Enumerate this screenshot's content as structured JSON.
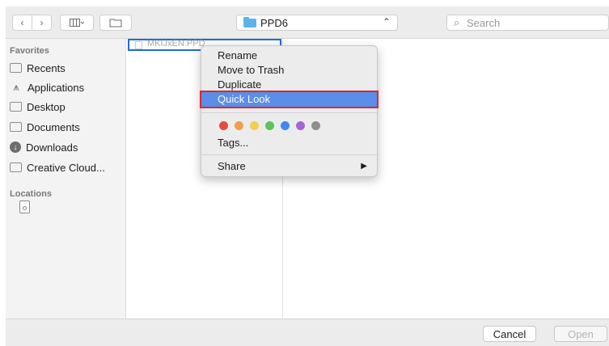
{
  "toolbar": {
    "back_icon": "chevron-left",
    "forward_icon": "chevron-right",
    "view_icon": "column-view",
    "new_folder_icon": "new-folder",
    "path": {
      "label": "PPD6",
      "arrows": "⌃⌄"
    },
    "search": {
      "placeholder": "Search"
    }
  },
  "sidebar": {
    "favorites_header": "Favorites",
    "items": [
      {
        "label": "Recents",
        "icon": "recents-icon"
      },
      {
        "label": "Applications",
        "icon": "applications-icon"
      },
      {
        "label": "Desktop",
        "icon": "desktop-icon"
      },
      {
        "label": "Documents",
        "icon": "documents-icon"
      },
      {
        "label": "Downloads",
        "icon": "downloads-icon"
      },
      {
        "label": "Creative Cloud...",
        "icon": "folder-icon"
      }
    ],
    "locations_header": "Locations"
  },
  "file": {
    "name": "MKIJxEN.PPD"
  },
  "context_menu": {
    "items": [
      "Rename",
      "Move to Trash",
      "Duplicate",
      "Quick Look"
    ],
    "highlighted": "Quick Look",
    "tags": [
      "#e74c3c",
      "#f0a04b",
      "#f3cf4e",
      "#5cc45b",
      "#3f88f0",
      "#a466d6",
      "#8e8e8e"
    ],
    "tags_label": "Tags...",
    "share_label": "Share",
    "share_arrow": "▶"
  },
  "footer": {
    "cancel": "Cancel",
    "open": "Open"
  },
  "colors": {
    "accent": "#1e6ce0",
    "highlight": "#5a8ee8",
    "selection_outline": "#e0262b"
  }
}
